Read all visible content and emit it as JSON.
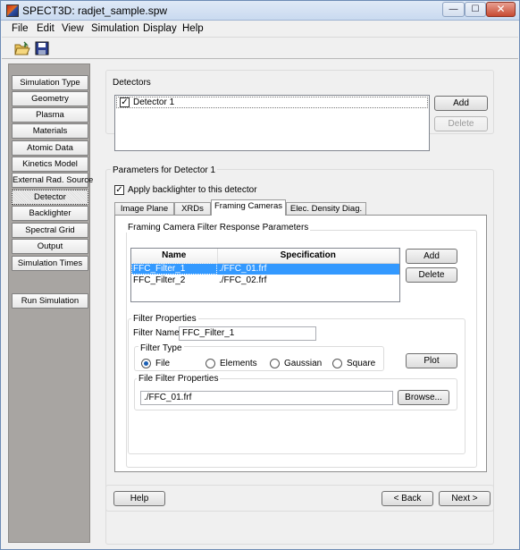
{
  "window": {
    "title": "SPECT3D:  radjet_sample.spw",
    "min": "—",
    "max": "☐",
    "close": "✕"
  },
  "menu": [
    "File",
    "Edit",
    "View",
    "Simulation",
    "Display",
    "Help"
  ],
  "nav": {
    "items": [
      "Simulation Type",
      "Geometry",
      "Plasma",
      "Materials",
      "Atomic Data",
      "Kinetics Model",
      "External Rad. Source",
      "Detector",
      "Backlighter",
      "Spectral Grid",
      "Output",
      "Simulation Times"
    ],
    "active": "Detector",
    "run": "Run Simulation"
  },
  "detectors": {
    "title": "Detectors",
    "items": [
      {
        "label": "Detector 1",
        "checked": true
      }
    ],
    "add": "Add",
    "delete": "Delete"
  },
  "params": {
    "title": "Parameters for Detector 1",
    "backlighter_label": "Apply backlighter to this detector",
    "backlighter_checked": true,
    "tabs": [
      "Image Plane",
      "XRDs",
      "Framing Cameras",
      "Elec. Density Diag."
    ],
    "active_tab": "Framing Cameras"
  },
  "framing": {
    "title": "Framing Camera Filter Response Parameters",
    "columns": [
      "Name",
      "Specification"
    ],
    "rows": [
      {
        "name": "FFC_Filter_1",
        "spec": "./FFC_01.frf"
      },
      {
        "name": "FFC_Filter_2",
        "spec": "./FFC_02.frf"
      }
    ],
    "add": "Add",
    "delete": "Delete"
  },
  "filter_props": {
    "title": "Filter Properties",
    "name_label": "Filter Name:",
    "name_value": "FFC_Filter_1",
    "type_title": "Filter Type",
    "types": [
      "File",
      "Elements",
      "Gaussian",
      "Square"
    ],
    "selected_type": "File",
    "plot": "Plot",
    "file_title": "File Filter Properties",
    "file_value": "./FFC_01.frf",
    "browse": "Browse..."
  },
  "footer": {
    "help": "Help",
    "back": "< Back",
    "next": "Next >"
  }
}
